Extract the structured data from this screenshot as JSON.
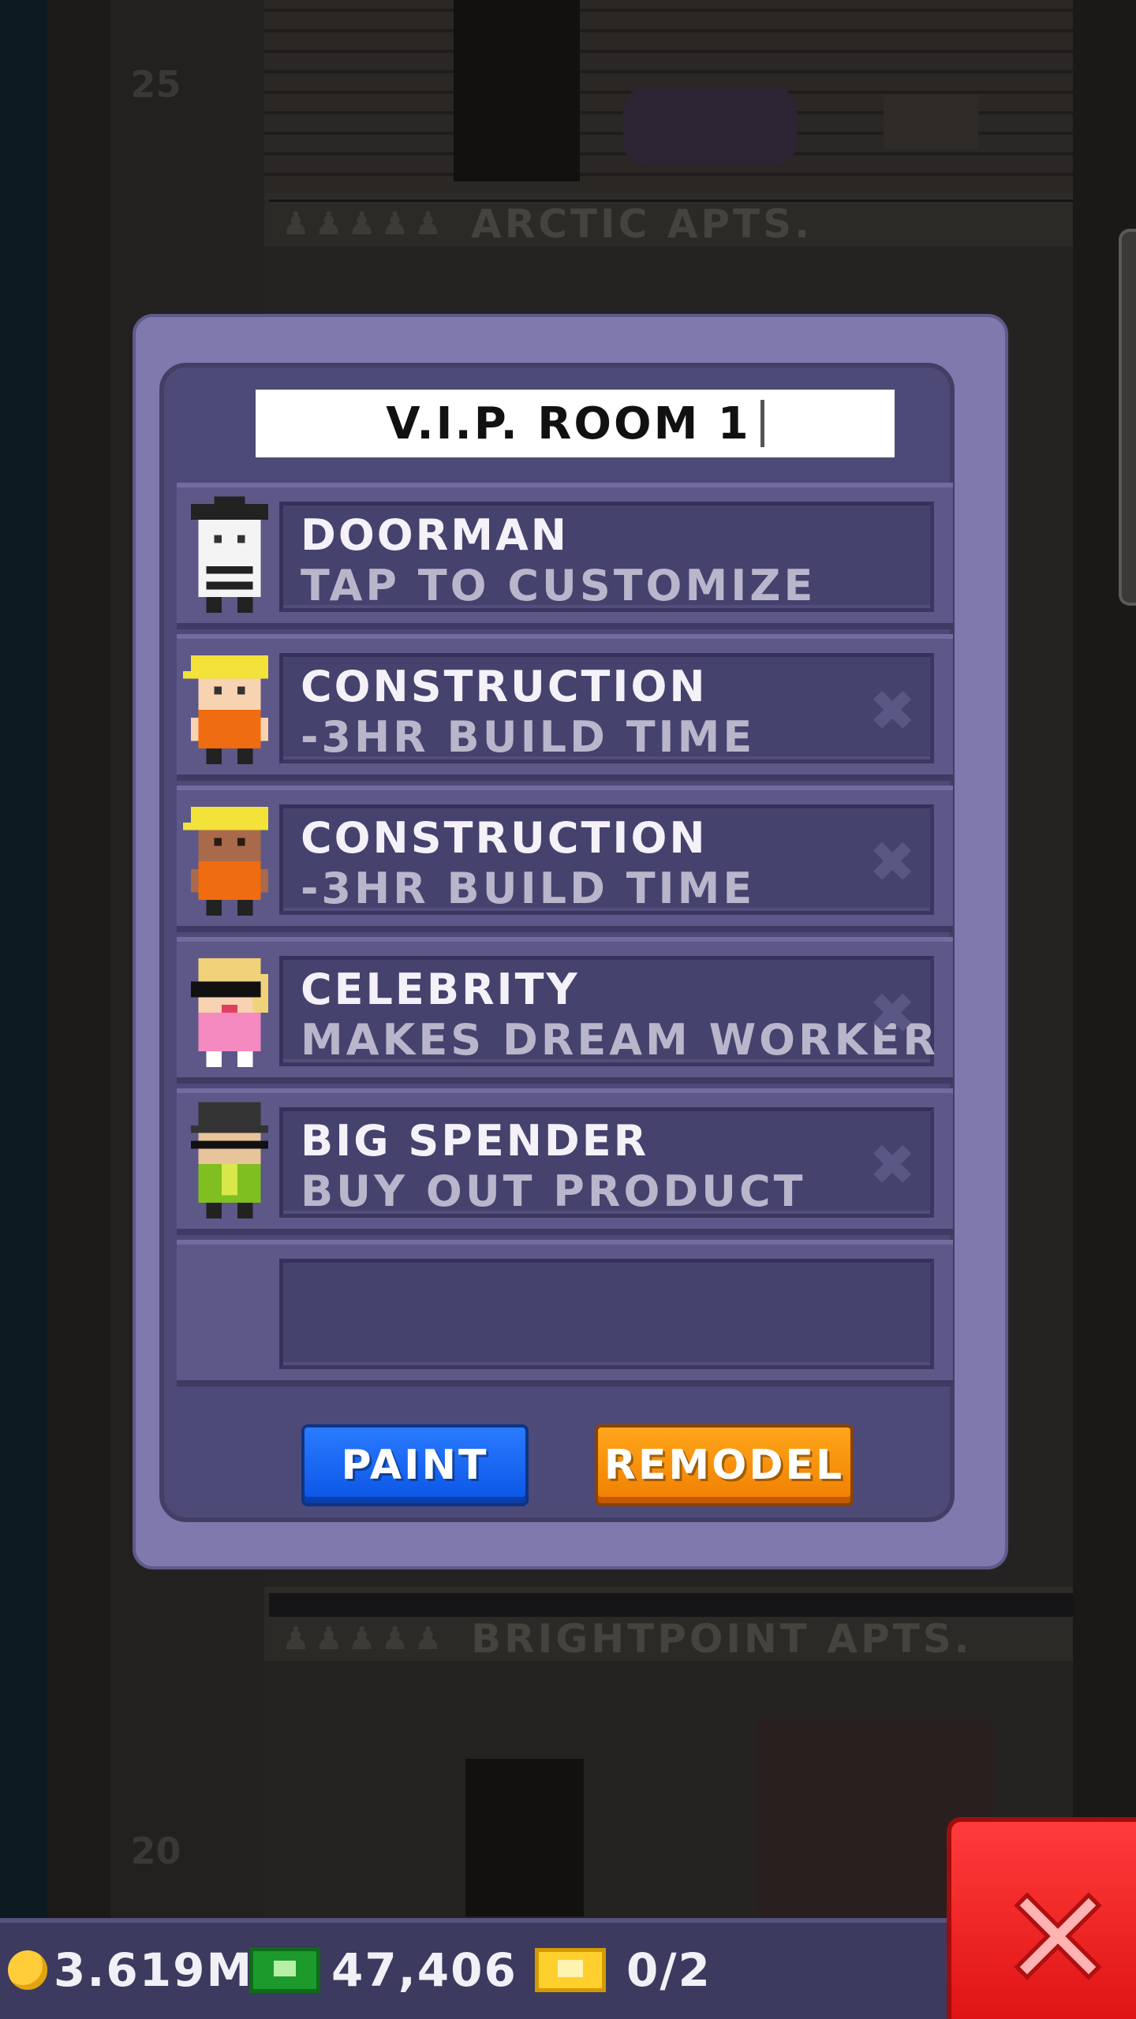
{
  "room": {
    "name": "V.I.P. ROOM 1"
  },
  "background": {
    "floor_labels": [
      "ARCTIC APTS.",
      "BRIGHTPOINT APTS."
    ],
    "floor_numbers": [
      "25",
      "20"
    ]
  },
  "bitizens": [
    {
      "title": "DOORMAN",
      "subtitle": "TAP TO CUSTOMIZE",
      "removable": false,
      "avatar": "doorman-avatar"
    },
    {
      "title": "CONSTRUCTION",
      "subtitle": "-3HR BUILD TIME",
      "removable": true,
      "avatar": "construction-worker-avatar"
    },
    {
      "title": "CONSTRUCTION",
      "subtitle": "-3HR BUILD TIME",
      "removable": true,
      "avatar": "construction-worker-avatar"
    },
    {
      "title": "CELEBRITY",
      "subtitle": "MAKES DREAM WORKER",
      "removable": true,
      "avatar": "celebrity-avatar"
    },
    {
      "title": "BIG SPENDER",
      "subtitle": "BUY OUT PRODUCT",
      "removable": true,
      "avatar": "big-spender-avatar"
    }
  ],
  "buttons": {
    "paint": "PAINT",
    "remodel": "REMODEL"
  },
  "status_bar": {
    "coins": "3.619M",
    "bux": "47,406",
    "tickets": "0/2"
  },
  "icons": {
    "remove": "x-icon",
    "close": "close-icon",
    "coin": "coin-icon",
    "bux": "bux-icon",
    "ticket": "vip-ticket-icon"
  },
  "colors": {
    "modal_bg": "#4e4a77",
    "paint_button": "#0b55e6",
    "remodel_button": "#f07e00",
    "close_button": "#e01414"
  }
}
